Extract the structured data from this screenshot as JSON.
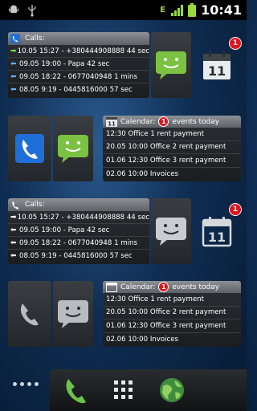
{
  "status_bar": {
    "time": "10:41",
    "network_type": "E",
    "icons": [
      "android-debug-icon",
      "usb-icon",
      "signal-icon",
      "battery-icon"
    ]
  },
  "widget1": {
    "calls_title": "Calls:",
    "calls": [
      {
        "direction": "out",
        "text": "10.05 15:27 - +380444908888 44 sec"
      },
      {
        "direction": "in",
        "text": "09.05 19:00 - Papa 42 sec"
      },
      {
        "direction": "in",
        "text": "09.05 18:22 - 0677040948 1 mins"
      },
      {
        "direction": "in",
        "text": "08.05 9:19 - 0445816000 57 sec"
      }
    ],
    "calendar_badge": "1",
    "calendar_day": "11"
  },
  "widget2": {
    "calendar_icon_day": "11",
    "calendar_label": "Calendar:",
    "badge": "1",
    "events_today": "events today",
    "events": [
      "12:30 Office 1 rent payment",
      "20.05 10:00 Office 2 rent payment",
      "01.06 12:30 Office 3 rent payment",
      "02.06 10:00 Invoices"
    ]
  },
  "widget3": {
    "calls_title": "Calls:",
    "calls": [
      {
        "direction": "out",
        "text": "10.05 15:27 - +380444908888 44 sec"
      },
      {
        "direction": "in",
        "text": "09.05 19:00 - Papa 42 sec"
      },
      {
        "direction": "in",
        "text": "09.05 18:22 - 0677040948 1 mins"
      },
      {
        "direction": "in",
        "text": "08.05 9:19 - 0445816000 57 sec"
      }
    ],
    "calendar_badge": "1",
    "calendar_day": "11"
  },
  "widget4": {
    "calendar_label": "Calendar:",
    "badge": "1",
    "events_today": "events today",
    "events": [
      "12:30 Office 1 rent payment",
      "20.05 10:00 Office 2 rent payment",
      "01.06 12:30 Office 3 rent payment",
      "02.06 10:00 Invoices"
    ]
  },
  "dock": {
    "items": [
      "more-icon",
      "phone-icon",
      "app-drawer-icon",
      "browser-globe-icon"
    ]
  },
  "colors": {
    "badge": "#e0141c",
    "sms_green": "#7bc142",
    "phone_blue": "#1e6fd9"
  }
}
